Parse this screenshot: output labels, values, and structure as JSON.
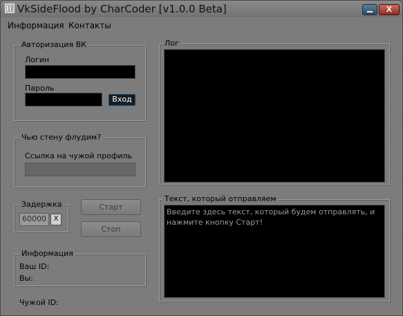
{
  "window": {
    "title": "VkSideFlood by CharCoder [v1.0.0 Beta]",
    "close_glyph": "X",
    "minimize_icon": "minimize-icon",
    "app_icon": "grid-app-icon"
  },
  "menu": {
    "items": [
      "Информация",
      "Контакты"
    ]
  },
  "auth": {
    "legend": "Авторизация ВК",
    "login_label": "Логин",
    "login_value": "",
    "password_label": "Пароль",
    "password_value": "",
    "login_button": "Вход"
  },
  "target": {
    "legend": "Чью стену флудим?",
    "link_label": "Ссылка на чужой профиль",
    "link_value": ""
  },
  "delay": {
    "legend": "Задержка",
    "value": "60000",
    "clear_button": "X"
  },
  "controls": {
    "start": "Старт",
    "stop": "Стоп"
  },
  "info": {
    "legend": "Информация",
    "your_id": "Ваш ID:",
    "you": "Вы:",
    "other_id": "Чужой ID:"
  },
  "log": {
    "legend": "Лог",
    "content": ""
  },
  "message": {
    "legend": "Текст, который отправляем",
    "text": "Введите здесь текст, который будем отправлять, и нажмите кнопку Старт!"
  },
  "colors": {
    "window_bg": "#7b7b7b",
    "field_bg": "#000000",
    "close_button": "#a33b30",
    "minimize_button": "#3e5e79",
    "login_button_border": "#5a7f9c"
  }
}
